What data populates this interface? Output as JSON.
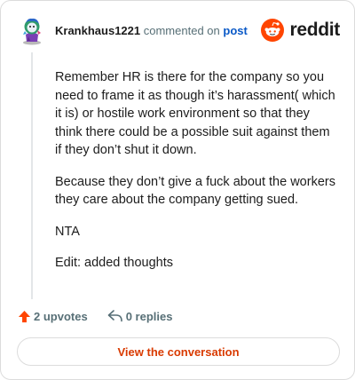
{
  "comment": {
    "author": "Krankhaus1221",
    "action": "commented on",
    "link_text": "post",
    "paragraphs": [
      "Remember HR is there for the company so you need to frame it as though it’s harassment( which it is) or hostile work environment so that they think there could be a possible suit against them if they don’t shut it down.",
      "Because they don’t give a fuck about the workers they care about the company getting sued.",
      "NTA",
      "Edit: added thoughts"
    ]
  },
  "brand": {
    "name": "reddit",
    "icon": "reddit-snoo-icon",
    "accent_color": "#ff4500"
  },
  "stats": {
    "upvotes": "2 upvotes",
    "replies": "0 replies"
  },
  "cta": {
    "label": "View the conversation",
    "color": "#d93a00"
  }
}
